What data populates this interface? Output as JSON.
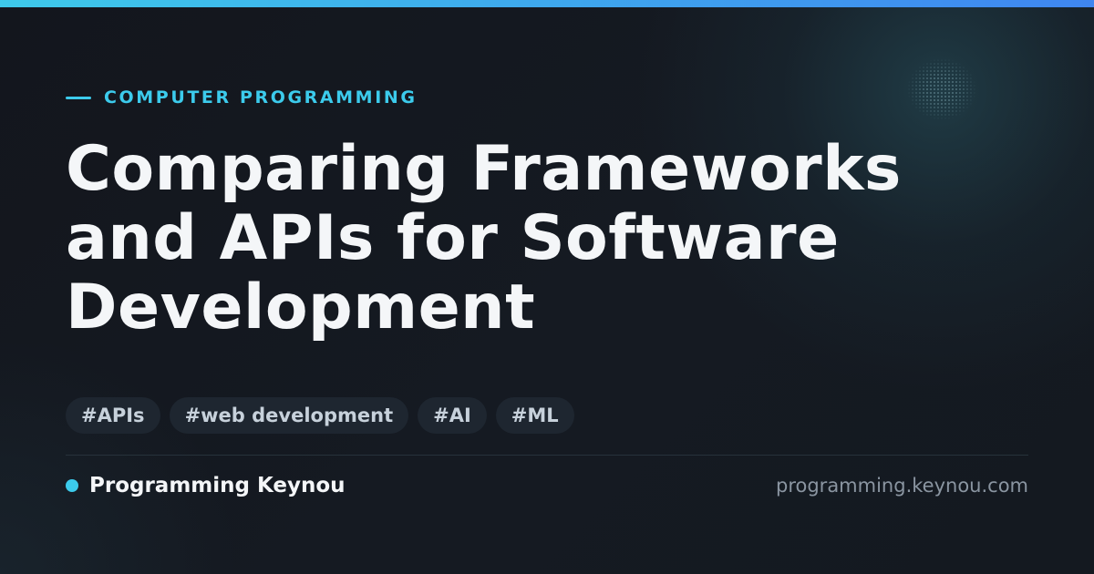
{
  "accent_color": "#3ccbec",
  "gradient_end_color": "#3f86f0",
  "category": {
    "label": "COMPUTER PROGRAMMING"
  },
  "title": {
    "lines": [
      "Comparing Frameworks",
      "and APIs for Software",
      "Development"
    ]
  },
  "tags": [
    "#APIs",
    "#web development",
    "#AI",
    "#ML"
  ],
  "footer": {
    "brand_name": "Programming Keynou",
    "site_url": "programming.keynou.com"
  }
}
